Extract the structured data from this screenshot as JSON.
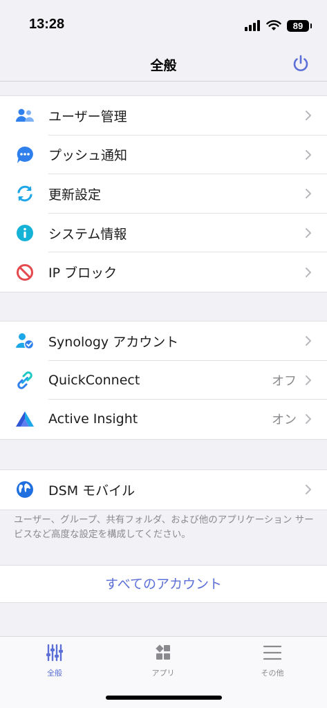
{
  "status_bar": {
    "time": "13:28",
    "battery": "89",
    "signal_icon": "signal-bars-icon",
    "wifi_icon": "wifi-icon"
  },
  "header": {
    "title": "全般",
    "power_icon": "power-icon"
  },
  "accent_color": "#5b6fd6",
  "sections": [
    {
      "items": [
        {
          "label": "ユーザー管理",
          "icon": "users-icon"
        },
        {
          "label": "プッシュ通知",
          "icon": "chat-bubble-icon"
        },
        {
          "label": "更新設定",
          "icon": "refresh-icon"
        },
        {
          "label": "システム情報",
          "icon": "info-icon"
        },
        {
          "label": "IP ブロック",
          "icon": "block-icon"
        }
      ]
    },
    {
      "items": [
        {
          "label": "Synology アカウント",
          "icon": "account-check-icon"
        },
        {
          "label": "QuickConnect",
          "value": "オフ",
          "icon": "link-icon"
        },
        {
          "label": "Active Insight",
          "value": "オン",
          "icon": "active-insight-icon"
        }
      ]
    },
    {
      "items": [
        {
          "label": "DSM モバイル",
          "icon": "globe-icon"
        }
      ]
    }
  ],
  "footnote": "ユーザー、グループ、共有フォルダ、および他のアプリケーション サービスなど高度な設定を構成してください。",
  "all_accounts_label": "すべてのアカウント",
  "tabs": [
    {
      "label": "全般",
      "icon": "sliders-icon",
      "active": true
    },
    {
      "label": "アプリ",
      "icon": "apps-grid-icon",
      "active": false
    },
    {
      "label": "その他",
      "icon": "menu-icon",
      "active": false
    }
  ]
}
